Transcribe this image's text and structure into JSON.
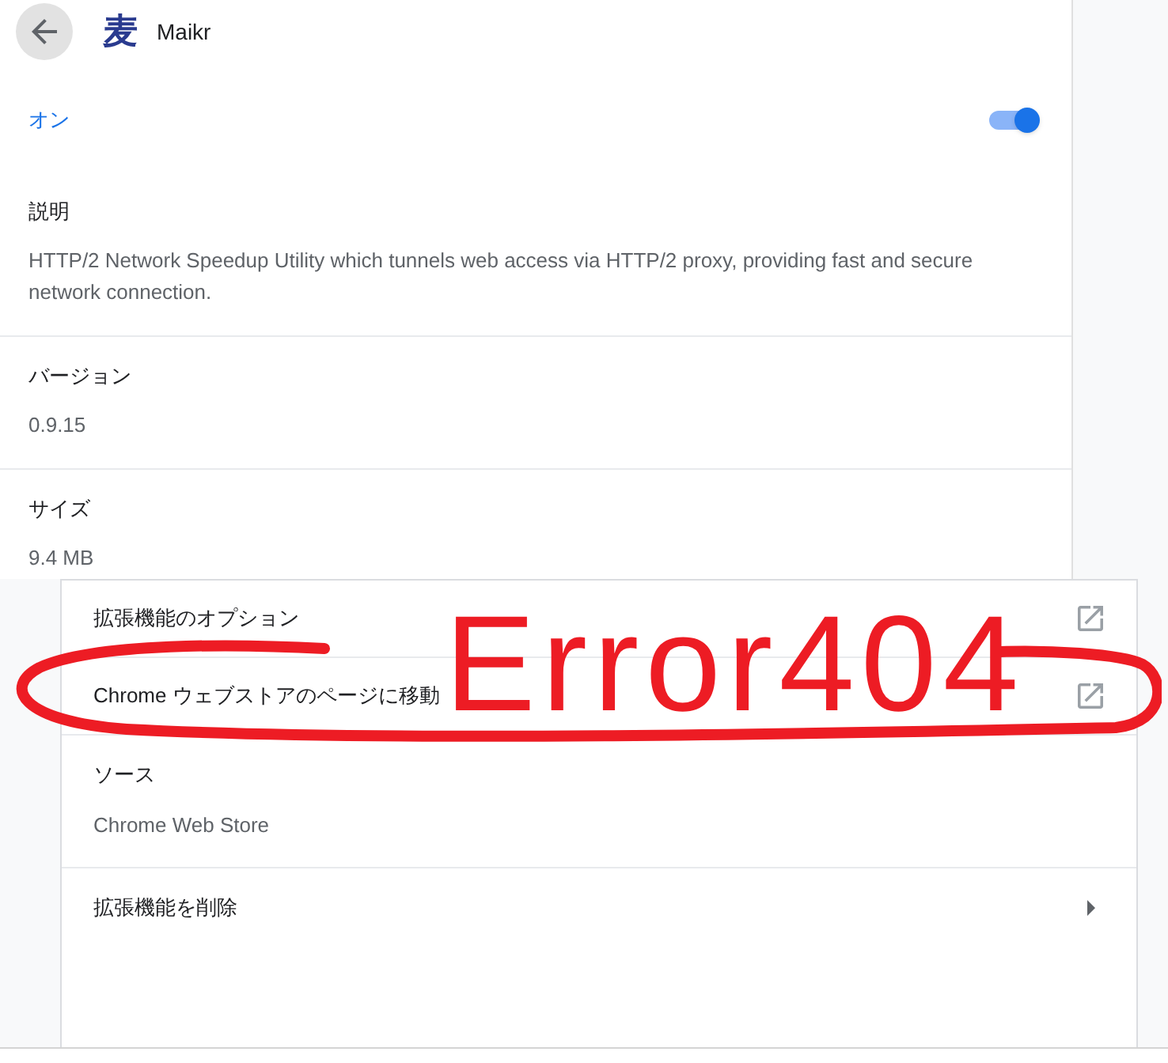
{
  "header": {
    "logo": "麦",
    "title": "Maikr"
  },
  "enable": {
    "label": "オン",
    "on": true
  },
  "details": [
    {
      "label": "説明",
      "value": "HTTP/2 Network Speedup Utility which tunnels web access via HTTP/2 proxy, providing fast and secure network connection."
    },
    {
      "label": "バージョン",
      "value": "0.9.15"
    },
    {
      "label": "サイズ",
      "value": "9.4 MB"
    }
  ],
  "links": [
    {
      "kind": "external",
      "label": "拡張機能のオプション"
    },
    {
      "kind": "external",
      "label": "Chrome ウェブストアのページに移動"
    },
    {
      "kind": "info",
      "label": "ソース",
      "value": "Chrome Web Store"
    },
    {
      "kind": "submenu",
      "label": "拡張機能を削除"
    }
  ],
  "annotation": {
    "text": "Error404"
  }
}
